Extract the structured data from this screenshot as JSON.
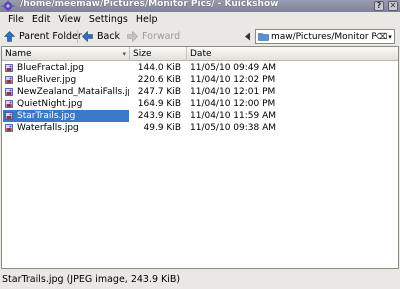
{
  "window": {
    "title": "/home/meemaw/Pictures/Monitor Pics/ - Kuickshow",
    "icons": {
      "app": "app-icon",
      "close": "close-icon",
      "help": "help-icon"
    },
    "close_glyph": "✕",
    "help_glyph": "?"
  },
  "menubar": {
    "items": [
      "File",
      "Edit",
      "View",
      "Settings",
      "Help"
    ]
  },
  "toolbar": {
    "parent_label": "Parent Folder",
    "back_label": "Back",
    "forward_label": "Forward",
    "icons": {
      "parent": "up-arrow-icon",
      "back": "left-arrow-icon",
      "forward": "right-arrow-icon",
      "location": "location-icon"
    },
    "location_path": "maw/Pictures/Monitor Pics/",
    "clear_glyph": "⌫",
    "dropdown_glyph": "▾"
  },
  "filelist": {
    "columns": {
      "name": "Name",
      "size": "Size",
      "date": "Date"
    },
    "sort_indicator": "▾",
    "rows": [
      {
        "name": "BlueFractal.jpg",
        "size": "144.0 KiB",
        "date": "11/05/10 09:49 AM",
        "selected": false
      },
      {
        "name": "BlueRiver.jpg",
        "size": "220.6 KiB",
        "date": "11/04/10 12:02 PM",
        "selected": false
      },
      {
        "name": "NewZealand_MataiFalls.jpg",
        "size": "247.7 KiB",
        "date": "11/04/10 12:01 PM",
        "selected": false
      },
      {
        "name": "QuietNight.jpg",
        "size": "164.9 KiB",
        "date": "11/04/10 12:00 PM",
        "selected": false
      },
      {
        "name": "StarTrails.jpg",
        "size": "243.9 KiB",
        "date": "11/04/10 11:59 AM",
        "selected": true
      },
      {
        "name": "Waterfalls.jpg",
        "size": "49.9 KiB",
        "date": "11/05/10 09:38 AM",
        "selected": false
      }
    ],
    "file_icon": "image-file-icon"
  },
  "statusbar": {
    "text": "StarTrails.jpg (JPEG image, 243.9 KiB)"
  },
  "colors": {
    "titlebar": "#8c8fa6",
    "selection": "#3a78c8",
    "window_bg": "#eae8e3"
  }
}
